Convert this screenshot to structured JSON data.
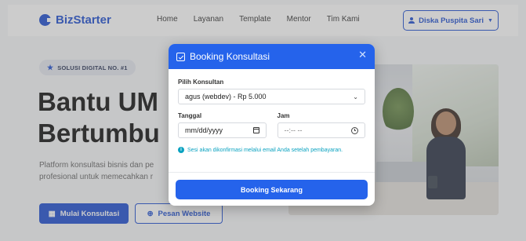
{
  "brand": {
    "name": "BizStarter"
  },
  "nav": {
    "links": [
      "Home",
      "Layanan",
      "Template",
      "Mentor",
      "Tim Kami"
    ],
    "user_name": "Diska Puspita Sari"
  },
  "hero": {
    "badge": "SOLUSI DIGITAL NO. #1",
    "title_line1": "Bantu UM",
    "title_line2": "Bertumbu",
    "desc_line1": "Platform konsultasi bisnis dan pe",
    "desc_line2": "profesional untuk memecahkan r",
    "primary_button": "Mulai Konsultasi",
    "secondary_button": "Pesan Website"
  },
  "modal": {
    "title": "Booking Konsultasi",
    "consultant_label": "Pilih Konsultan",
    "consultant_value": "agus (webdev) - Rp 5.000",
    "date_label": "Tanggal",
    "date_placeholder": "mm/dd/yyyy",
    "time_label": "Jam",
    "time_placeholder": "--:-- --",
    "info_text": "Sesi akan dikonfirmasi melalui email Anda setelah pembayaran.",
    "submit_label": "Booking Sekarang"
  },
  "colors": {
    "primary": "#2563eb",
    "brand": "#1f4fd1",
    "info": "#0aa2c0"
  }
}
